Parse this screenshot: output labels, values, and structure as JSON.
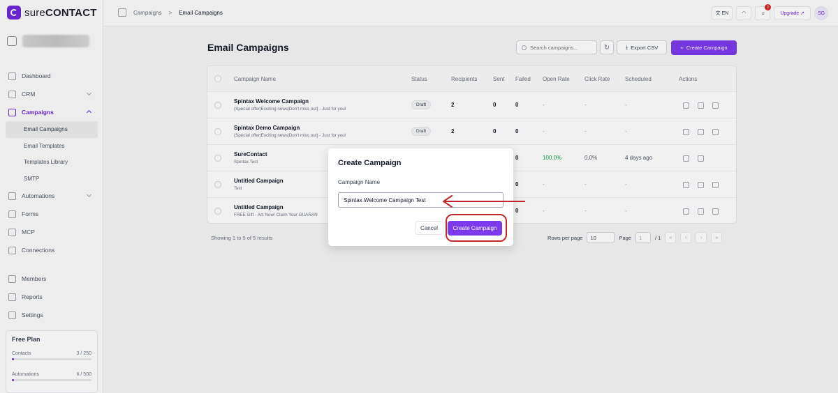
{
  "app": {
    "logo_text_lower": "sure",
    "logo_text_upper": "CONTACT"
  },
  "sidebar": {
    "items": [
      {
        "label": "Dashboard"
      },
      {
        "label": "CRM"
      },
      {
        "label": "Campaigns"
      },
      {
        "label": "Automations"
      },
      {
        "label": "Forms"
      },
      {
        "label": "MCP"
      },
      {
        "label": "Connections"
      },
      {
        "label": "Members"
      },
      {
        "label": "Reports"
      },
      {
        "label": "Settings"
      }
    ],
    "campaign_sub": [
      {
        "label": "Email Campaigns"
      },
      {
        "label": "Email Templates"
      },
      {
        "label": "Templates Library"
      },
      {
        "label": "SMTP"
      }
    ],
    "plan": {
      "title": "Free Plan",
      "contacts_label": "Contacts",
      "contacts_value": "3 / 250",
      "contacts_fraction": 0.012,
      "automations_label": "Automations",
      "automations_value": "6 / 500",
      "automations_fraction": 0.012
    }
  },
  "topbar": {
    "breadcrumb": [
      "Campaigns",
      "Email Campaigns"
    ],
    "lang": "EN",
    "notifications": "1",
    "upgrade": "Upgrade",
    "avatar": "SG"
  },
  "page": {
    "title": "Email Campaigns",
    "search_placeholder": "Search campaigns...",
    "export_label": "Export CSV",
    "create_label": "Create Campaign"
  },
  "table": {
    "columns": [
      "Campaign Name",
      "Status",
      "Recipients",
      "Sent",
      "Failed",
      "Open Rate",
      "Click Rate",
      "Scheduled",
      "Actions"
    ],
    "rows": [
      {
        "name": "Spintax Welcome Campaign",
        "subject": "{Special offer|Exciting news|Don't miss out} - Just for you!",
        "status": "Draft",
        "recipients": "2",
        "sent": "0",
        "failed": "0",
        "open": "-",
        "click": "-",
        "scheduled": "-"
      },
      {
        "name": "Spintax Demo Campaign",
        "subject": "{Special offer|Exciting news|Don't miss out} - Just for you!",
        "status": "Draft",
        "recipients": "2",
        "sent": "0",
        "failed": "0",
        "open": "-",
        "click": "-",
        "scheduled": "-"
      },
      {
        "name": "SureContact",
        "subject": "Spintax Test",
        "status": "",
        "recipients": "",
        "sent": "",
        "failed": "0",
        "open": "100.0%",
        "click": "0.0%",
        "scheduled": "4 days ago"
      },
      {
        "name": "Untitled Campaign",
        "subject": "Test",
        "status": "",
        "recipients": "",
        "sent": "",
        "failed": "0",
        "open": "-",
        "click": "-",
        "scheduled": "-"
      },
      {
        "name": "Untitled Campaign",
        "subject": "FREE Gift - Act Now! Claim Your GUARAN",
        "status": "",
        "recipients": "",
        "sent": "",
        "failed": "0",
        "open": "-",
        "click": "-",
        "scheduled": "-"
      }
    ],
    "showing": "Showing 1 to 5 of 5 results",
    "rows_per_page_label": "Rows per page",
    "rows_per_page": "10",
    "page_label": "Page",
    "page_value": "1",
    "page_total": "/ 1"
  },
  "modal": {
    "title": "Create Campaign",
    "field_label": "Campaign Name",
    "field_value": "Spintax Welcome Campaign Test",
    "cancel_label": "Cancel",
    "create_label": "Create Campaign"
  },
  "colors": {
    "accent": "#7c3aed",
    "annotation": "#c0282d",
    "positive": "#16a34a"
  }
}
